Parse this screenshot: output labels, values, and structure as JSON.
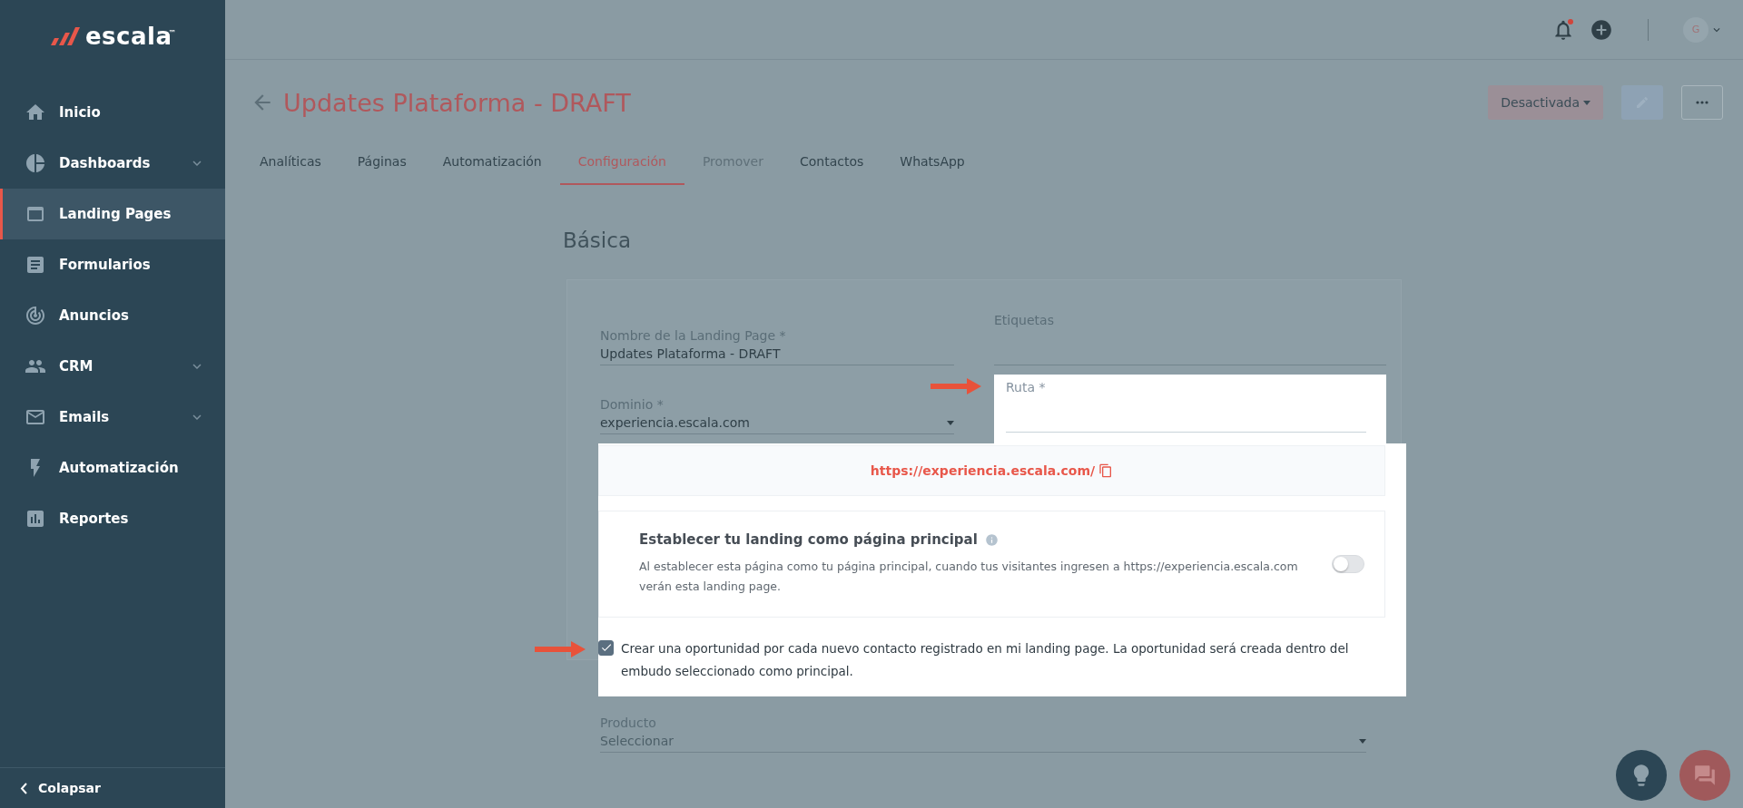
{
  "sidebar": {
    "logo": "escala",
    "trademark": "™",
    "items": [
      {
        "label": "Inicio",
        "selected": false,
        "expandable": false
      },
      {
        "label": "Dashboards",
        "selected": false,
        "expandable": true
      },
      {
        "label": "Landing Pages",
        "selected": true,
        "expandable": false
      },
      {
        "label": "Formularios",
        "selected": false,
        "expandable": false
      },
      {
        "label": "Anuncios",
        "selected": false,
        "expandable": false
      },
      {
        "label": "CRM",
        "selected": false,
        "expandable": true
      },
      {
        "label": "Emails",
        "selected": false,
        "expandable": true
      },
      {
        "label": "Automatización",
        "selected": false,
        "expandable": false
      },
      {
        "label": "Reportes",
        "selected": false,
        "expandable": false
      }
    ],
    "collapse": "Colapsar"
  },
  "header": {
    "notifications_unread": true,
    "avatar_initial": "G"
  },
  "page": {
    "title": "Updates Plataforma - DRAFT",
    "status_button": "Desactivada",
    "tabs": [
      {
        "label": "Analíticas",
        "selected": false,
        "disabled": false
      },
      {
        "label": "Páginas",
        "selected": false,
        "disabled": false
      },
      {
        "label": "Automatización",
        "selected": false,
        "disabled": false
      },
      {
        "label": "Configuración",
        "selected": true,
        "disabled": false
      },
      {
        "label": "Promover",
        "selected": false,
        "disabled": true
      },
      {
        "label": "Contactos",
        "selected": false,
        "disabled": false
      },
      {
        "label": "WhatsApp",
        "selected": false,
        "disabled": false
      }
    ]
  },
  "section_title": "Básica",
  "form": {
    "name_field": {
      "label": "Nombre de la Landing Page *",
      "value": "Updates Plataforma - DRAFT"
    },
    "tags_field": {
      "label": "Etiquetas"
    },
    "domain_field": {
      "label": "Dominio *",
      "value": "experiencia.escala.com"
    },
    "route_field": {
      "label": "Ruta *"
    },
    "url": "https://experiencia.escala.com/",
    "homepage": {
      "title": "Establecer tu landing como página principal",
      "description": "Al establecer esta página como tu página principal, cuando tus visitantes ingresen a https://experiencia.escala.com verán esta landing page.",
      "on": false
    },
    "opportunity": {
      "text": "Crear una oportunidad por cada nuevo contacto registrado en mi landing page. La oportunidad será creada dentro del embudo seleccionado como principal.",
      "checked": true
    },
    "product_field": {
      "label": "Producto",
      "placeholder": "Seleccionar"
    }
  }
}
